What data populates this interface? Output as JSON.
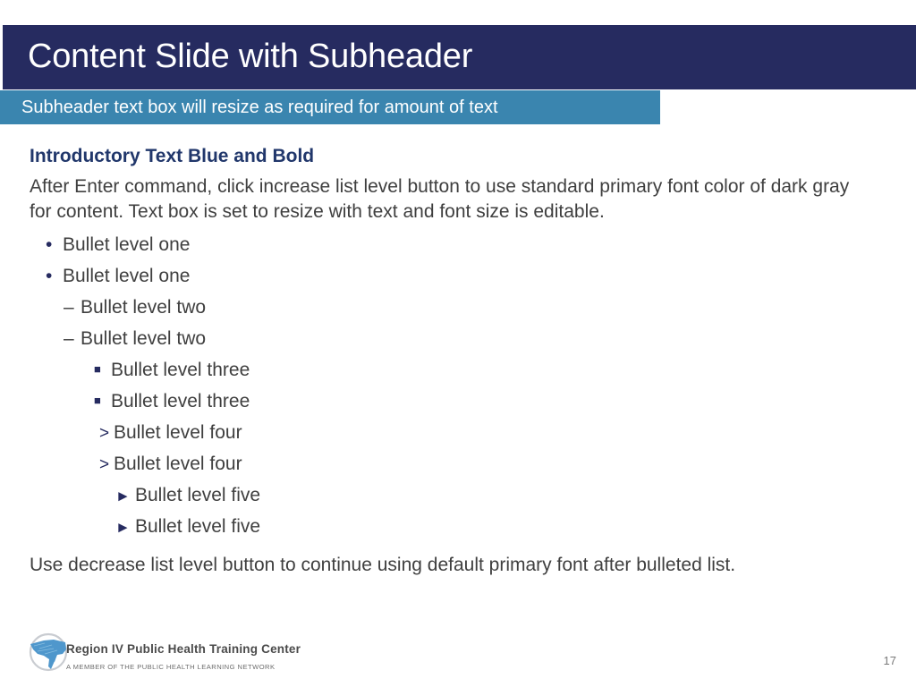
{
  "slide": {
    "title": "Content Slide with Subheader",
    "subheader": "Subheader text box will resize as required for amount of text",
    "colors": {
      "title_bar": "#262B60",
      "subheader_bar": "#3A85AF",
      "heading_text": "#21376B",
      "body_text": "#3F3F3F",
      "bullet_marker": "#262B60",
      "background": "#FFFFFF"
    }
  },
  "body": {
    "intro_heading": "Introductory Text Blue and Bold",
    "intro_paragraph": "After Enter command, click increase list level button to use standard primary font color of dark gray for content. Text box is set to resize with text and font size is editable.",
    "closing_paragraph": "Use decrease list level button to continue using default primary font after bulleted list.",
    "bullets": [
      {
        "level": 1,
        "marker": "•",
        "marker_name": "bullet-dot-icon",
        "text": "Bullet level one"
      },
      {
        "level": 1,
        "marker": "•",
        "marker_name": "bullet-dot-icon",
        "text": "Bullet level one"
      },
      {
        "level": 2,
        "marker": "–",
        "marker_name": "bullet-dash-icon",
        "text": "Bullet level two"
      },
      {
        "level": 2,
        "marker": "–",
        "marker_name": "bullet-dash-icon",
        "text": "Bullet level two"
      },
      {
        "level": 3,
        "marker": "■",
        "marker_name": "bullet-square-icon",
        "text": "Bullet level three"
      },
      {
        "level": 3,
        "marker": "■",
        "marker_name": "bullet-square-icon",
        "text": "Bullet level three"
      },
      {
        "level": 4,
        "marker": ">",
        "marker_name": "bullet-chevron-icon",
        "text": "Bullet level four"
      },
      {
        "level": 4,
        "marker": ">",
        "marker_name": "bullet-chevron-icon",
        "text": "Bullet level four"
      },
      {
        "level": 5,
        "marker": "►",
        "marker_name": "bullet-triangle-icon",
        "text": "Bullet level five"
      },
      {
        "level": 5,
        "marker": "►",
        "marker_name": "bullet-triangle-icon",
        "text": "Bullet level five"
      }
    ]
  },
  "footer": {
    "logo_title": "Region IV Public Health Training Center",
    "logo_subtitle": "A MEMBER OF THE PUBLIC HEALTH LEARNING NETWORK",
    "page_number": "17"
  }
}
